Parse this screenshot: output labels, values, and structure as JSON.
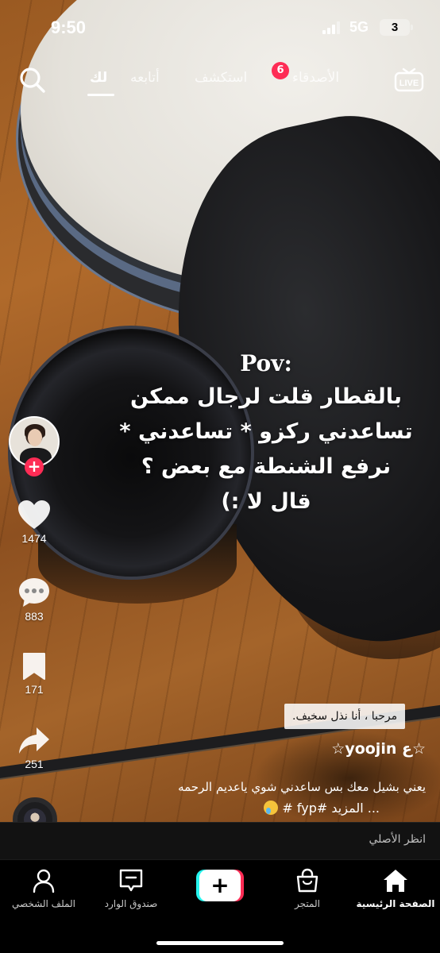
{
  "status_bar": {
    "time": "9:50",
    "network": "5G",
    "battery": "3"
  },
  "top_nav": {
    "tabs": [
      {
        "label": "لك",
        "active": true
      },
      {
        "label": "أتابعه",
        "active": false
      },
      {
        "label": "استكشف",
        "active": false
      },
      {
        "label": "الأصدقاء",
        "active": false
      }
    ],
    "friends_badge": "6",
    "live_label": "LIVE"
  },
  "overlay_text": {
    "pov": "Pov:",
    "lines": [
      "بالقطار قلت لرجال  ممكن",
      "تساعدني ركزو * تساعدني *",
      "نرفع الشنطة مع بعض ؟",
      "قال لا :)"
    ]
  },
  "rail": {
    "likes": "1474",
    "comments": "883",
    "saves": "171",
    "shares": "251"
  },
  "post": {
    "sticker": "مرحبا ، أنا نذل سخيف.",
    "author": "☆ع yoojin☆",
    "description": "يعني بشيل معك بس ساعدني شوي ياعديم الرحمه",
    "description_more": "... المزيد #fyp #"
  },
  "see_original": "انظر الأصلي",
  "tab_bar": {
    "items": [
      {
        "label": "الملف الشخصي",
        "icon": "profile-icon"
      },
      {
        "label": "صندوق الوارد",
        "icon": "inbox-icon"
      },
      {
        "label": "",
        "icon": "create-icon"
      },
      {
        "label": "المتجر",
        "icon": "shop-icon"
      },
      {
        "label": "الصفحة الرئيسية",
        "icon": "home-icon",
        "active": true
      }
    ]
  },
  "colors": {
    "accent_red": "#fe2c55",
    "accent_cyan": "#25f4ee"
  }
}
